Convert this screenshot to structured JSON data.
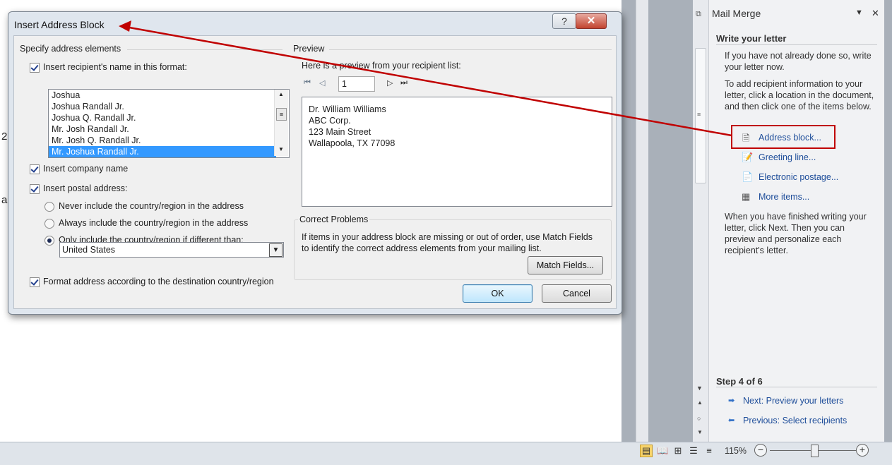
{
  "document": {
    "fragments": [
      "2",
      "a"
    ]
  },
  "dialog": {
    "title": "Insert Address Block",
    "help_label": "?",
    "close_label": "✕",
    "specify": {
      "header": "Specify address elements",
      "insert_name_label": "Insert recipient's name in this format:",
      "name_formats": [
        "Joshua",
        "Joshua Randall Jr.",
        "Joshua Q. Randall Jr.",
        "Mr. Josh Randall Jr.",
        "Mr. Josh Q. Randall Jr.",
        "Mr. Joshua Randall Jr."
      ],
      "selected_format": "Mr. Joshua Randall Jr.",
      "insert_company_label": "Insert company name",
      "insert_postal_label": "Insert postal address:",
      "radio_never": "Never include the country/region in the address",
      "radio_always": "Always include the country/region in the address",
      "radio_only": "Only include the country/region if different than:",
      "country_value": "United States",
      "format_address_label": "Format address according to the destination country/region"
    },
    "preview": {
      "header": "Preview",
      "subheader": "Here is a preview from your recipient list:",
      "record_number": "1",
      "address_lines": [
        "Dr. William Williams",
        "ABC Corp.",
        "123 Main Street",
        "Wallapoola, TX 77098"
      ]
    },
    "correct": {
      "header": "Correct Problems",
      "text": "If items in your address block are missing or out of order, use Match Fields to identify the correct address elements from your mailing list.",
      "match_fields_label": "Match Fields..."
    },
    "ok_label": "OK",
    "cancel_label": "Cancel"
  },
  "pane": {
    "title": "Mail Merge",
    "section_title": "Write your letter",
    "intro_text": "If you have not already done so, write your letter now.",
    "instructions": "To add recipient information to your letter, click a location in the document, and then click one of the items below.",
    "links": [
      "Address block...",
      "Greeting line...",
      "Electronic postage...",
      "More items..."
    ],
    "finish_text": "When you have finished writing your letter, click Next. Then you can preview and personalize each recipient's letter.",
    "step_label": "Step 4 of 6",
    "next_label": "Next: Preview your letters",
    "previous_label": "Previous: Select recipients"
  },
  "status": {
    "zoom": "115%"
  },
  "annotation_color": "#c00000"
}
